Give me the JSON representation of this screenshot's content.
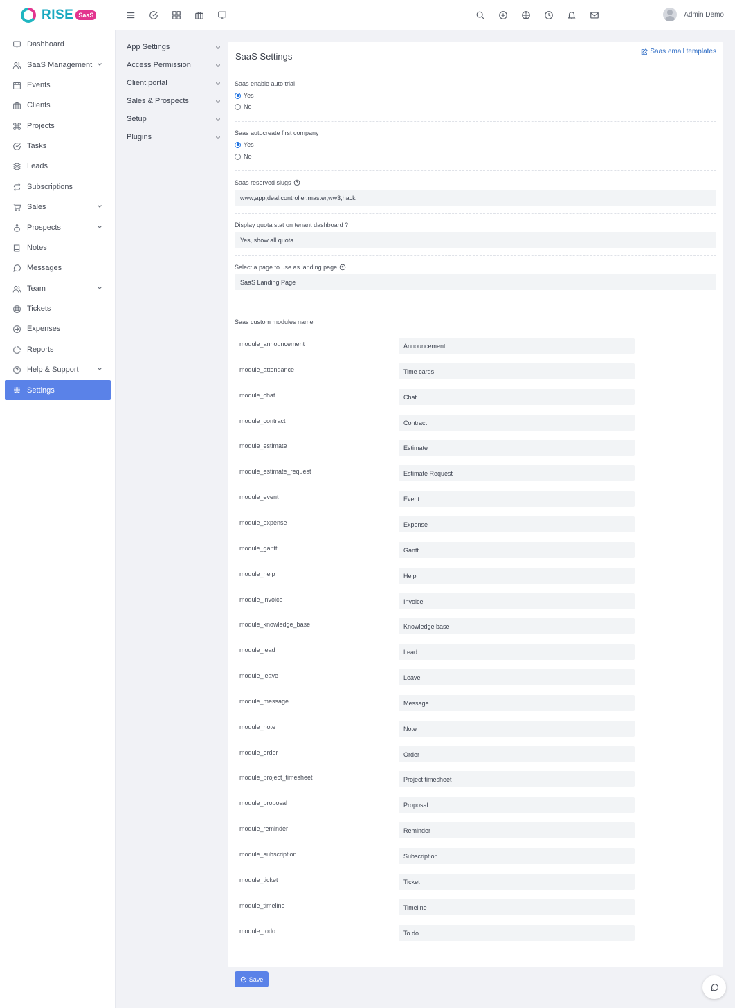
{
  "app": {
    "logo_text": "RISE",
    "logo_badge": "SaaS",
    "user_name": "Admin Demo"
  },
  "topbar": {
    "left_icons": [
      "menu-icon",
      "check-circle-icon",
      "apps-grid-icon",
      "briefcase-icon",
      "monitor-icon"
    ],
    "right_icons": [
      "search-icon",
      "plus-circle-icon",
      "globe-icon",
      "clock-icon",
      "bell-icon",
      "mail-icon"
    ]
  },
  "sidebar": {
    "active": "Settings",
    "accent_color": "#5a82e8",
    "items": [
      {
        "label": "Dashboard",
        "icon": "monitor-icon",
        "has_submenu": false
      },
      {
        "label": "SaaS Management",
        "icon": "users-icon",
        "has_submenu": true
      },
      {
        "label": "Events",
        "icon": "calendar-icon",
        "has_submenu": false
      },
      {
        "label": "Clients",
        "icon": "briefcase-icon",
        "has_submenu": false
      },
      {
        "label": "Projects",
        "icon": "command-icon",
        "has_submenu": false
      },
      {
        "label": "Tasks",
        "icon": "check-circle-icon",
        "has_submenu": false
      },
      {
        "label": "Leads",
        "icon": "layers-icon",
        "has_submenu": false
      },
      {
        "label": "Subscriptions",
        "icon": "repeat-icon",
        "has_submenu": false
      },
      {
        "label": "Sales",
        "icon": "cart-icon",
        "has_submenu": true
      },
      {
        "label": "Prospects",
        "icon": "anchor-icon",
        "has_submenu": true
      },
      {
        "label": "Notes",
        "icon": "book-icon",
        "has_submenu": false
      },
      {
        "label": "Messages",
        "icon": "message-icon",
        "has_submenu": false
      },
      {
        "label": "Team",
        "icon": "users-icon",
        "has_submenu": true
      },
      {
        "label": "Tickets",
        "icon": "life-buoy-icon",
        "has_submenu": false
      },
      {
        "label": "Expenses",
        "icon": "arrow-circle-icon",
        "has_submenu": false
      },
      {
        "label": "Reports",
        "icon": "pie-chart-icon",
        "has_submenu": false
      },
      {
        "label": "Help & Support",
        "icon": "help-circle-icon",
        "has_submenu": true
      },
      {
        "label": "Settings",
        "icon": "gear-icon",
        "has_submenu": false
      }
    ]
  },
  "settings_menu": {
    "items": [
      "App Settings",
      "Access Permission",
      "Client portal",
      "Sales & Prospects",
      "Setup",
      "Plugins"
    ]
  },
  "card": {
    "title": "SaaS Settings",
    "email_templates_link": "Saas email templates",
    "auto_trial": {
      "label": "Saas enable auto trial",
      "options": [
        "Yes",
        "No"
      ],
      "selected": "Yes"
    },
    "autocreate_company": {
      "label": "Saas autocreate first company",
      "options": [
        "Yes",
        "No"
      ],
      "selected": "Yes"
    },
    "reserved_slugs": {
      "label": "Saas reserved slugs",
      "value": "www,app,deal,controller,master,ww3,hack"
    },
    "quota_stat": {
      "label": "Display quota stat on tenant dashboard ?",
      "value": "Yes, show all quota"
    },
    "landing_page": {
      "label": "Select a page to use as landing page",
      "value": "SaaS Landing Page"
    },
    "modules_label": "Saas custom modules name",
    "modules": [
      {
        "key": "module_announcement",
        "value": "Announcement"
      },
      {
        "key": "module_attendance",
        "value": "Time cards"
      },
      {
        "key": "module_chat",
        "value": "Chat"
      },
      {
        "key": "module_contract",
        "value": "Contract"
      },
      {
        "key": "module_estimate",
        "value": "Estimate"
      },
      {
        "key": "module_estimate_request",
        "value": "Estimate Request"
      },
      {
        "key": "module_event",
        "value": "Event"
      },
      {
        "key": "module_expense",
        "value": "Expense"
      },
      {
        "key": "module_gantt",
        "value": "Gantt"
      },
      {
        "key": "module_help",
        "value": "Help"
      },
      {
        "key": "module_invoice",
        "value": "Invoice"
      },
      {
        "key": "module_knowledge_base",
        "value": "Knowledge base"
      },
      {
        "key": "module_lead",
        "value": "Lead"
      },
      {
        "key": "module_leave",
        "value": "Leave"
      },
      {
        "key": "module_message",
        "value": "Message"
      },
      {
        "key": "module_note",
        "value": "Note"
      },
      {
        "key": "module_order",
        "value": "Order"
      },
      {
        "key": "module_project_timesheet",
        "value": "Project timesheet"
      },
      {
        "key": "module_proposal",
        "value": "Proposal"
      },
      {
        "key": "module_reminder",
        "value": "Reminder"
      },
      {
        "key": "module_subscription",
        "value": "Subscription"
      },
      {
        "key": "module_ticket",
        "value": "Ticket"
      },
      {
        "key": "module_timeline",
        "value": "Timeline"
      },
      {
        "key": "module_todo",
        "value": "To do"
      }
    ]
  },
  "save_label": "Save"
}
